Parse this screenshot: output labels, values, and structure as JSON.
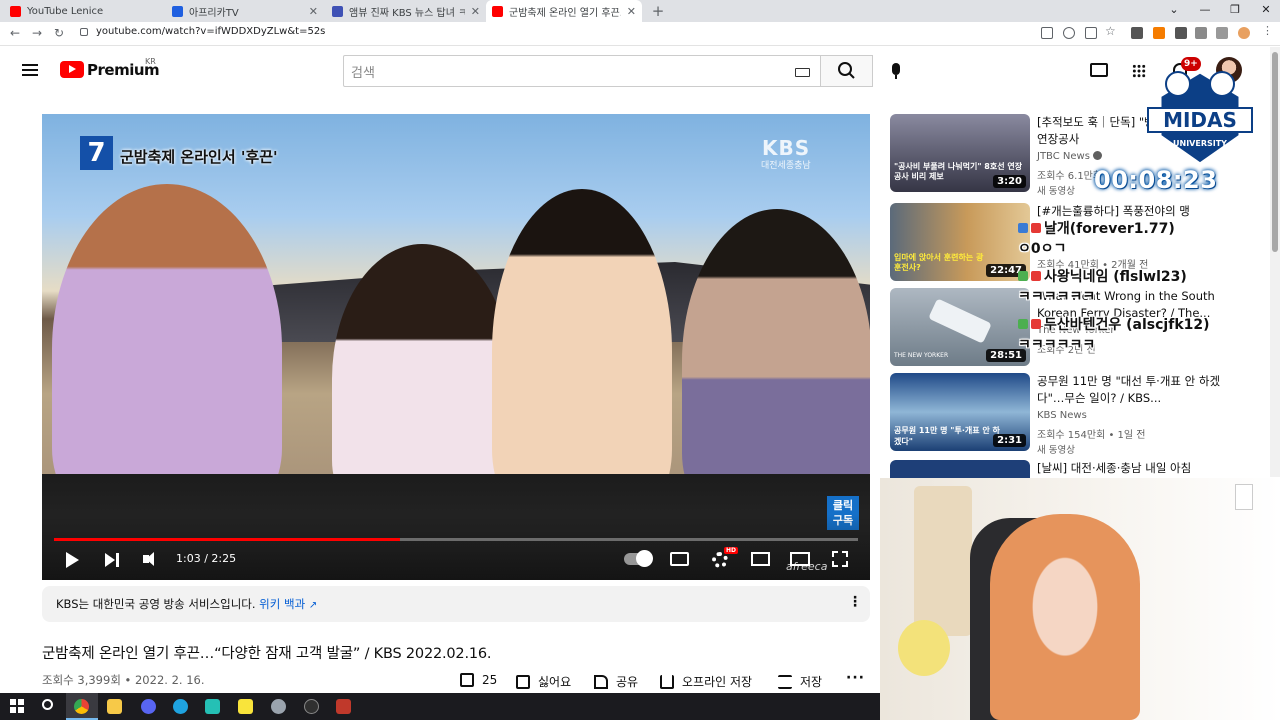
{
  "colors": {
    "accent_red": "#ff0000",
    "link_blue": "#065fd4",
    "progress_red": "#ff0000",
    "notif_red": "#cc0000"
  },
  "browser": {
    "tabs": [
      {
        "title": "YouTube Lenice",
        "favicon_color": "#ff0000"
      },
      {
        "title": "아프리카TV",
        "favicon_color": "#1f5fe0"
      },
      {
        "title": "앰뷰 진짜 KBS 뉴스 탑녀 ㅋㅋㅋ",
        "favicon_color": "#3f51b5"
      },
      {
        "title": "군밤축제 온라인 열기 후끈...'다",
        "favicon_color": "#ff0000"
      }
    ],
    "new_tab": "+",
    "url": "youtube.com/watch?v=ifWDDXDyZLw&t=52s"
  },
  "masthead": {
    "brand": "Premium",
    "region": "KR",
    "search_placeholder": "검색",
    "notifications": "9+"
  },
  "player": {
    "caption_number": "7",
    "caption": "군밤축제 온라인서 '후끈'",
    "channel_watermark": "KBS",
    "region_watermark": "대전세종충남",
    "subscribe_sticker": [
      "클릭",
      "구독"
    ],
    "time": "1:03 / 2:25",
    "progress": 0.43,
    "hd": "HD",
    "watermark": "afreeca"
  },
  "info": {
    "text": "KBS는 대한민국 공영 방송 서비스입니다.",
    "link": "위키 백과"
  },
  "video": {
    "title": "군밤축제 온라인 열기 후끈…“다양한 잠재 고객 발굴” / KBS 2022.02.16.",
    "meta": "조회수 3,399회 • 2022. 2. 16.",
    "actions": {
      "likes": "25",
      "dislike": "싫어요",
      "share": "공유",
      "download": "오프라인 저장",
      "save": "저장"
    }
  },
  "recommendations": [
    {
      "title": "[추적보도 훅｜단독] \"뻥 부풀리고\" 8호선 연장공사",
      "channel": "JTBC News",
      "verified": true,
      "views": "조회수 6.1만회",
      "badge": "새 동영상",
      "duration": "3:20",
      "thumb_text": "\"공사비 부풀려 나눠먹기\" 8호선 연장공사 비리 제보"
    },
    {
      "title": "[#개는훌륭하다] 폭풍전야의 맹",
      "channel": "",
      "views": "조회수 41만회 • 2개월 전",
      "duration": "22:47",
      "thumb_text": "입마에 앉아서 훈련하는 광훈전사?"
    },
    {
      "title": "What Went Wrong in the South Korean Ferry Disaster? / The...",
      "channel": "The New Yorker",
      "views": "조회수 2년 전",
      "duration": "28:51",
      "thumb_text": "THE NEW YORKER"
    },
    {
      "title": "공무원 11만 명 \"대선 투·개표 안 하겠다\"…무슨 일이? / KBS...",
      "channel": "KBS News",
      "views": "조회수 154만회 • 1일 전",
      "badge": "새 동영상",
      "duration": "2:31",
      "thumb_text": "공무원 11만 명 \"투·개표 안 하겠다\""
    },
    {
      "title": "[날씨] 대전·세종·충남 내일 아침",
      "channel": "",
      "views": "",
      "duration": "",
      "thumb_text": ""
    }
  ],
  "overlay": {
    "logo_text": "MIDAS",
    "logo_sub": "UNIVERSITY",
    "timer": "00:08:23",
    "chat": [
      {
        "name": "날개(forever1.77)",
        "badge_color": "#3a7bd5"
      },
      {
        "message": "ㅇ0ㅇㄱ"
      },
      {
        "name": "사왕닉네임 (flslwl23)",
        "badge_color": "#4caf50"
      },
      {
        "message": "ㅋㅋㅋㅋㅋㅋ"
      },
      {
        "name": "두산바텐건우 (alscjfk12)",
        "badge_color": "#4caf50"
      },
      {
        "message": "ㅋㅋㅋㅋㅋㅋ"
      }
    ]
  },
  "taskbar": {
    "icons": [
      "start-icon",
      "search-icon",
      "chrome-icon",
      "file-explorer-icon",
      "discord-icon",
      "edge-icon",
      "tiktok-icon",
      "sticky-notes-icon",
      "paint-icon",
      "obs-icon",
      "app-icon"
    ]
  }
}
